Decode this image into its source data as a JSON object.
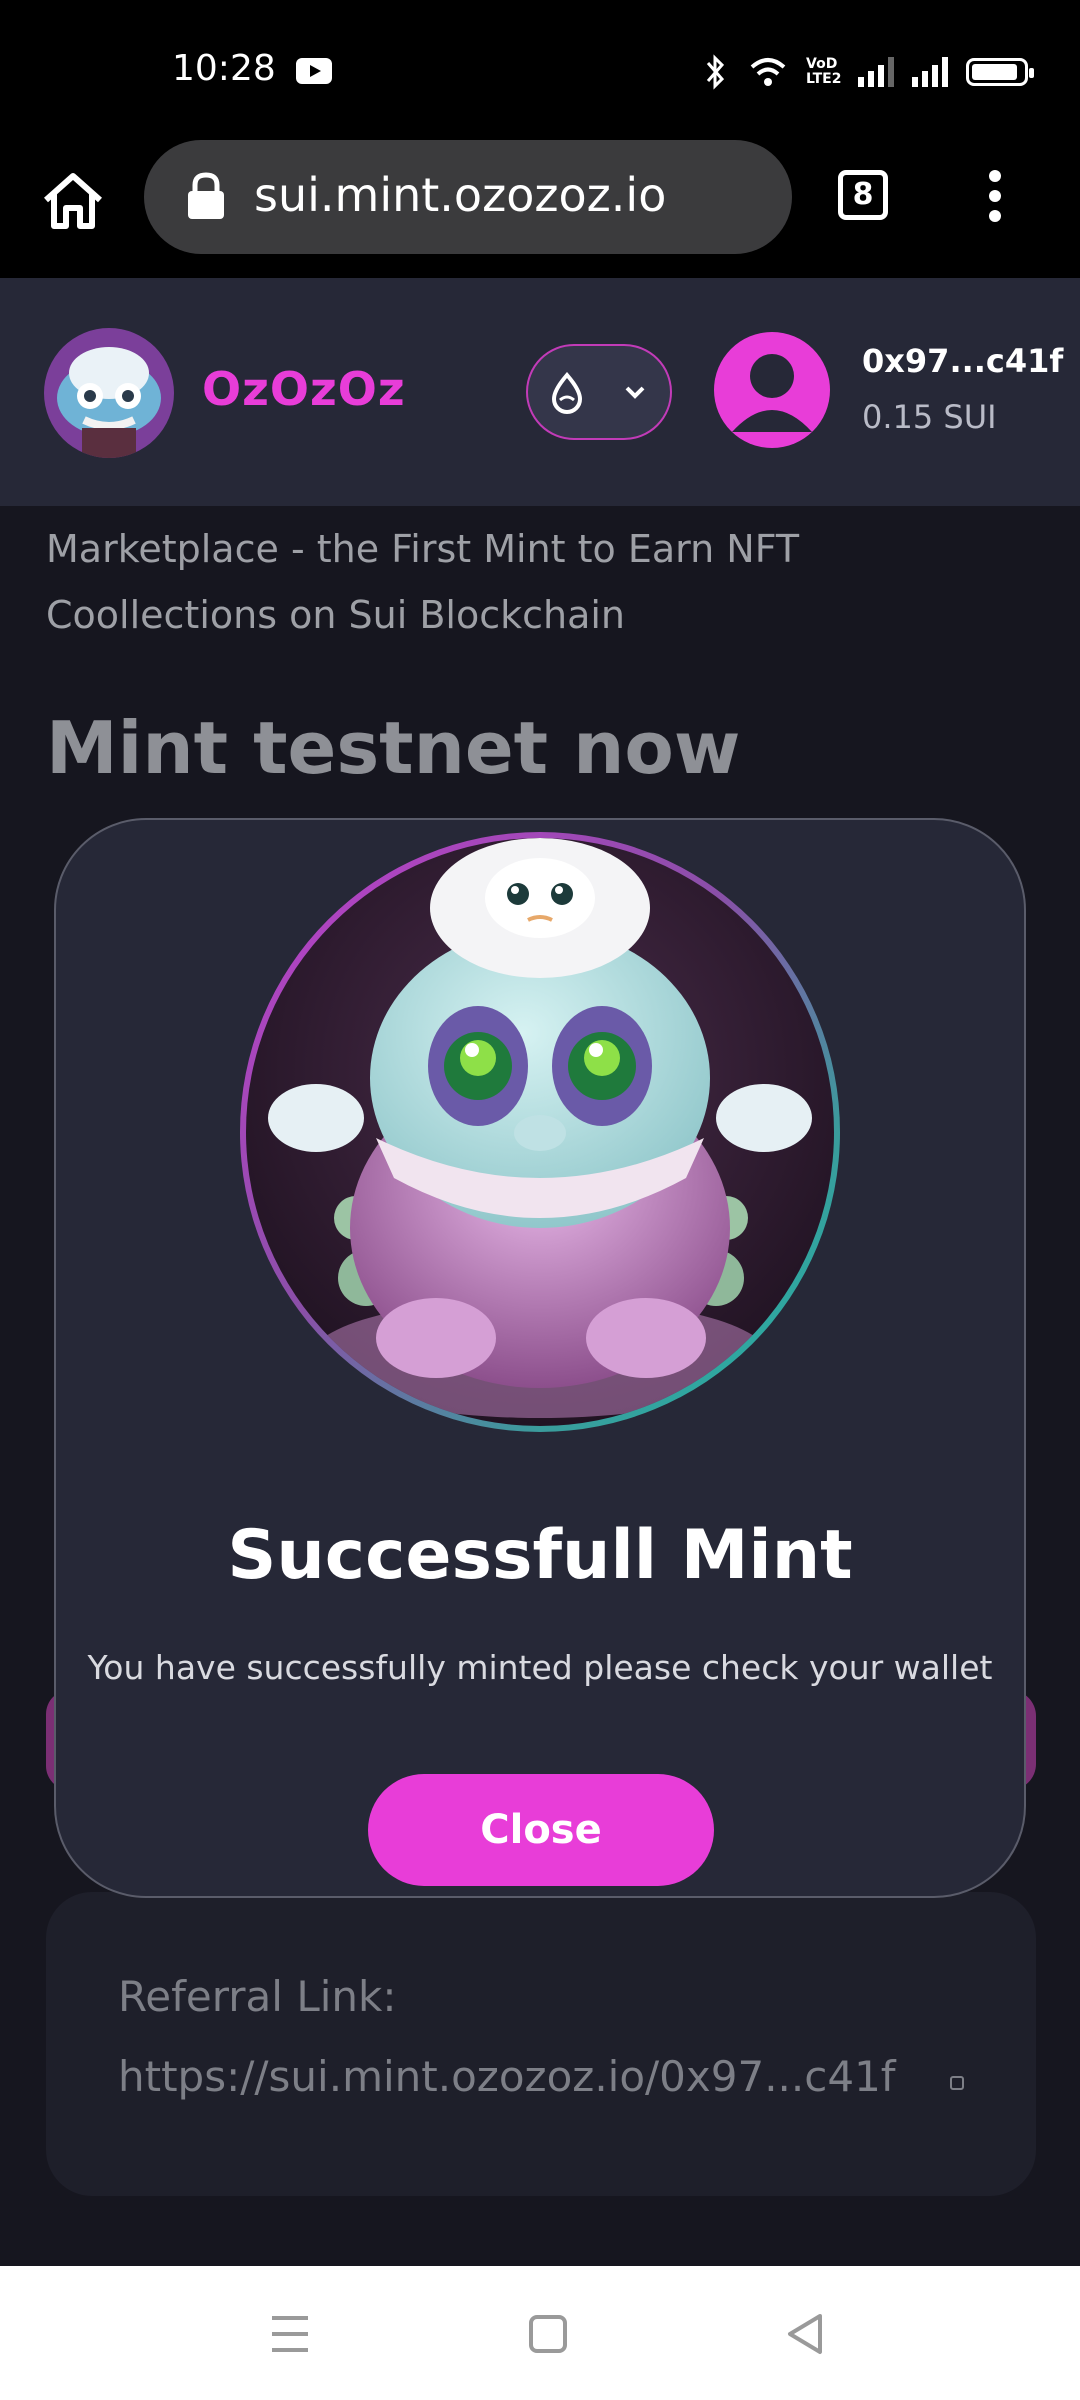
{
  "status_bar": {
    "time": "10:28",
    "lte_label": "VoD LTE2"
  },
  "browser": {
    "url": "sui.mint.ozozoz.io",
    "tab_count": "8"
  },
  "header": {
    "brand": "OzOzOz",
    "wallet_address": "0x97...c41f",
    "wallet_balance": "0.15 SUI"
  },
  "page": {
    "subtitle": "Marketplace - the First Mint to Earn NFT Coollections on Sui Blockchain",
    "heading": "Mint testnet now"
  },
  "referral": {
    "label": "Referral Link:",
    "link": "https://sui.mint.ozozoz.io/0x97...c41f"
  },
  "modal": {
    "title": "Successfull Mint",
    "message": "You have successfully minted please check your wallet",
    "close_label": "Close"
  },
  "colors": {
    "accent": "#e83dd8",
    "background": "#16161f",
    "header_bg": "#262837"
  }
}
